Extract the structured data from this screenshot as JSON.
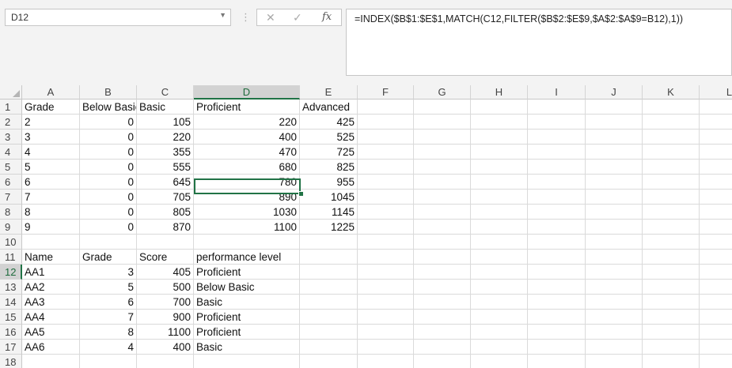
{
  "name_box": {
    "value": "D12"
  },
  "formula_bar": {
    "cancel_glyph": "✕",
    "enter_glyph": "✓",
    "fx_label": "fx",
    "formula": "=INDEX($B$1:$E$1,MATCH(C12,FILTER($B$2:$E$9,$A$2:$A$9=B12),1))"
  },
  "columns": [
    "A",
    "B",
    "C",
    "D",
    "E",
    "F",
    "G",
    "H",
    "I",
    "J",
    "K",
    "L"
  ],
  "selected_column": "D",
  "rows": [
    "1",
    "2",
    "3",
    "4",
    "5",
    "6",
    "7",
    "8",
    "9",
    "10",
    "11",
    "12",
    "13",
    "14",
    "15",
    "16",
    "17",
    "18"
  ],
  "selected_row": "12",
  "cells": {
    "r1": {
      "A": "Grade",
      "B": "Below Basic",
      "C": "Basic",
      "D": "Proficient",
      "E": "Advanced"
    },
    "r2": {
      "A": "2",
      "B": "0",
      "C": "105",
      "D": "220",
      "E": "425"
    },
    "r3": {
      "A": "3",
      "B": "0",
      "C": "220",
      "D": "400",
      "E": "525"
    },
    "r4": {
      "A": "4",
      "B": "0",
      "C": "355",
      "D": "470",
      "E": "725"
    },
    "r5": {
      "A": "5",
      "B": "0",
      "C": "555",
      "D": "680",
      "E": "825"
    },
    "r6": {
      "A": "6",
      "B": "0",
      "C": "645",
      "D": "780",
      "E": "955"
    },
    "r7": {
      "A": "7",
      "B": "0",
      "C": "705",
      "D": "890",
      "E": "1045"
    },
    "r8": {
      "A": "8",
      "B": "0",
      "C": "805",
      "D": "1030",
      "E": "1145"
    },
    "r9": {
      "A": "9",
      "B": "0",
      "C": "870",
      "D": "1100",
      "E": "1225"
    },
    "r11": {
      "A": "Name",
      "B": "Grade",
      "C": "Score",
      "D": "performance level"
    },
    "r12": {
      "A": "AA1",
      "B": "3",
      "C": "405",
      "D": "Proficient"
    },
    "r13": {
      "A": "AA2",
      "B": "5",
      "C": "500",
      "D": "Below Basic"
    },
    "r14": {
      "A": "AA3",
      "B": "6",
      "C": "700",
      "D": "Basic"
    },
    "r15": {
      "A": "AA4",
      "B": "7",
      "C": "900",
      "D": "Proficient"
    },
    "r16": {
      "A": "AA5",
      "B": "8",
      "C": "1100",
      "D": "Proficient"
    },
    "r17": {
      "A": "AA6",
      "B": "4",
      "C": "400",
      "D": "Basic"
    }
  },
  "theme": {
    "accent": "#217346",
    "header_bg": "#f3f3f3",
    "gridline": "#dadada"
  }
}
